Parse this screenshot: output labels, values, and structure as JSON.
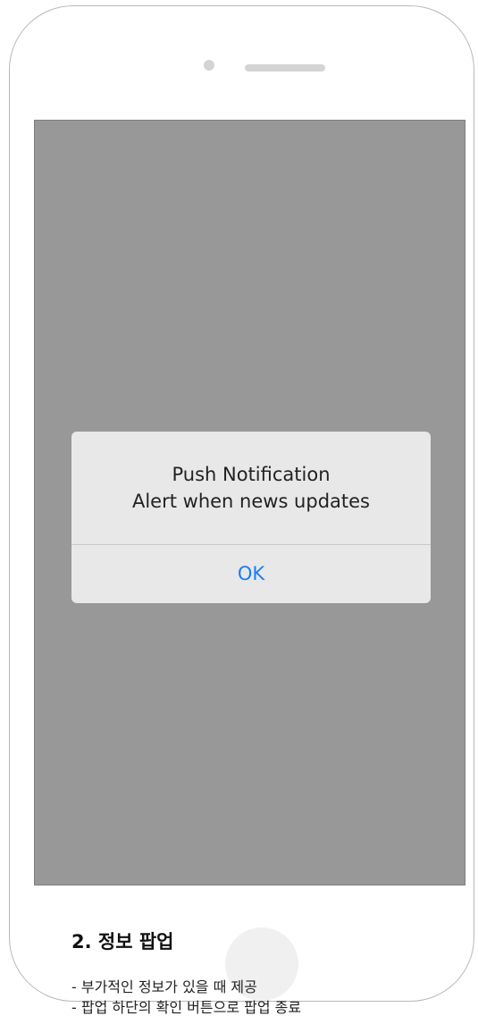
{
  "dialog": {
    "title": "Push Notification",
    "message": "Alert when news updates",
    "ok_label": "OK"
  },
  "section": {
    "title": "2. 정보 팝업",
    "descriptions": [
      "- 부가적인 정보가 있을 때 제공",
      "- 팝업 하단의 확인 버튼으로 팝업 종료"
    ]
  },
  "colors": {
    "screen_overlay": "#989898",
    "dialog_background": "#e8e8e8",
    "accent": "#1a7ef5"
  }
}
